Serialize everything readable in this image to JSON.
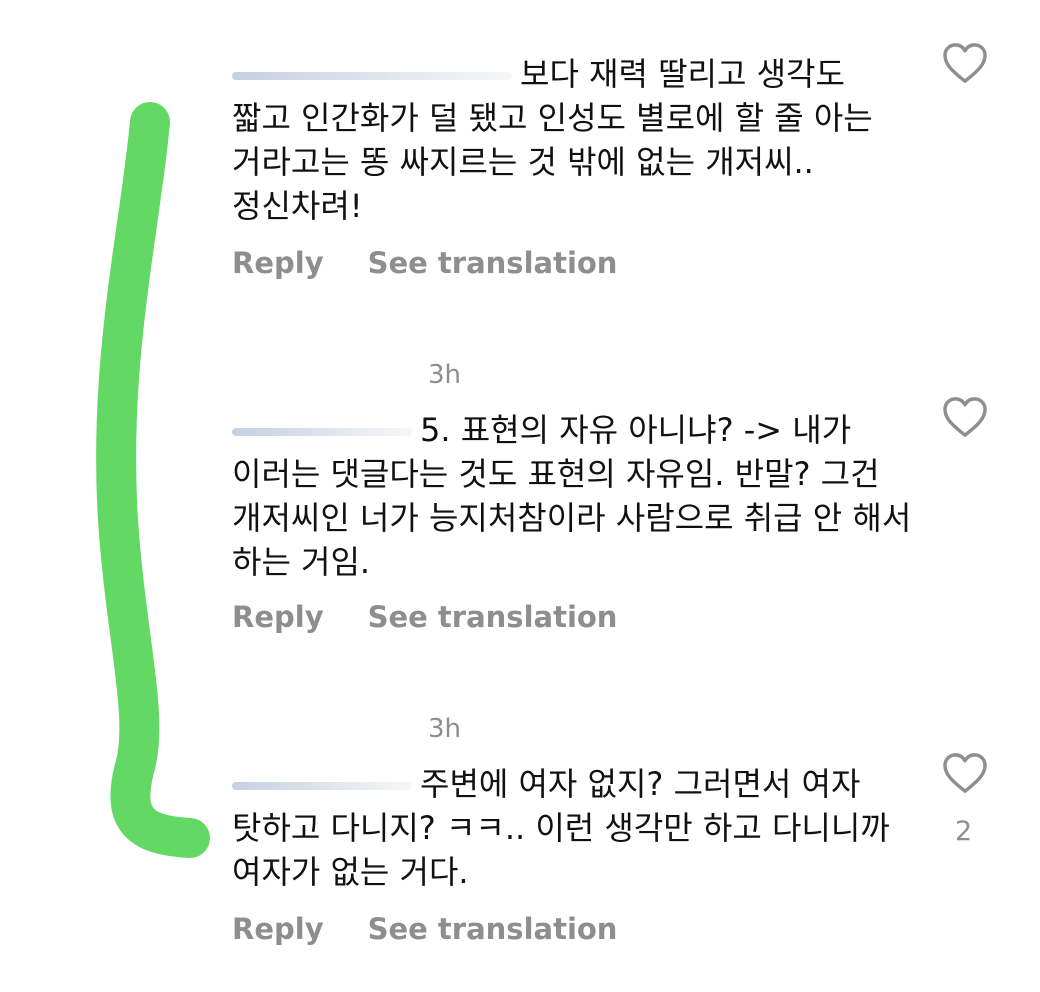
{
  "comments": [
    {
      "text": "보다 재력 딸리고 생각도 짧고 인간화가 덜 됐고 인성도 별로에 할 줄 아는 거라고는 똥 싸지르는 것 밖에 없는 개저씨.. 정신차려!",
      "reply_label": "Reply",
      "translate_label": "See translation",
      "like_count": ""
    },
    {
      "time": "3h",
      "text": "5. 표현의 자유 아니냐? -> 내가 이러는 댓글다는 것도 표현의 자유임. 반말? 그건 개저씨인 너가 능지처참이라 사람으로 취급 안 해서 하는 거임.",
      "reply_label": "Reply",
      "translate_label": "See translation",
      "like_count": ""
    },
    {
      "time": "3h",
      "text": "주변에 여자 없지? 그러면서 여자 탓하고 다니지? ㅋㅋ.. 이런 생각만 하고 다니니까 여자가 없는 거다.",
      "reply_label": "Reply",
      "translate_label": "See translation",
      "like_count": "2"
    }
  ],
  "icons": {
    "like": "heart-outline-icon"
  },
  "colors": {
    "thread_line": "#5cd65c",
    "meta_text": "#8e8e8e"
  }
}
